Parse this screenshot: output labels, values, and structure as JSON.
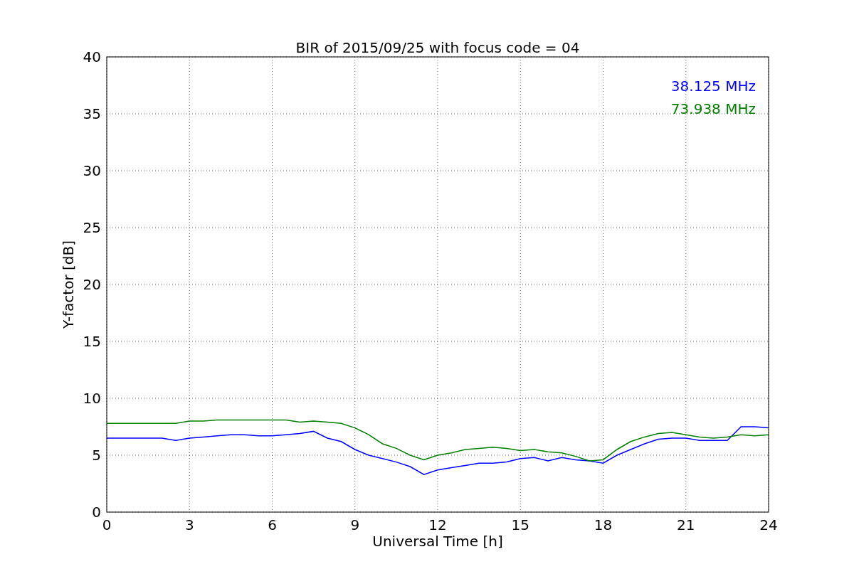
{
  "chart_data": {
    "type": "line",
    "title": "BIR of 2015/09/25 with focus code = 04",
    "xlabel": "Universal Time [h]",
    "ylabel": "Y-factor [dB]",
    "x": [
      0,
      0.5,
      1,
      1.5,
      2,
      2.5,
      3,
      3.5,
      4,
      4.5,
      5,
      5.5,
      6,
      6.5,
      7,
      7.5,
      8,
      8.5,
      9,
      9.5,
      10,
      10.5,
      11,
      11.5,
      12,
      12.5,
      13,
      13.5,
      14,
      14.5,
      15,
      15.5,
      16,
      16.5,
      17,
      17.5,
      18,
      18.5,
      19,
      19.5,
      20,
      20.5,
      21,
      21.5,
      22,
      22.5,
      23,
      23.5,
      24
    ],
    "series": [
      {
        "name": "38.125 MHz",
        "color": "#0000ff",
        "values": [
          6.5,
          6.5,
          6.5,
          6.5,
          6.5,
          6.3,
          6.5,
          6.6,
          6.7,
          6.8,
          6.8,
          6.7,
          6.7,
          6.8,
          6.9,
          7.1,
          6.5,
          6.2,
          5.5,
          5.0,
          4.7,
          4.4,
          4.0,
          3.3,
          3.7,
          3.9,
          4.1,
          4.3,
          4.3,
          4.4,
          4.7,
          4.8,
          4.5,
          4.8,
          4.6,
          4.5,
          4.3,
          5.0,
          5.5,
          6.0,
          6.4,
          6.5,
          6.5,
          6.3,
          6.3,
          6.3,
          7.5,
          7.5,
          7.4
        ]
      },
      {
        "name": "73.938 MHz",
        "color": "#008000",
        "values": [
          7.8,
          7.8,
          7.8,
          7.8,
          7.8,
          7.8,
          8.0,
          8.0,
          8.1,
          8.1,
          8.1,
          8.1,
          8.1,
          8.1,
          7.9,
          8.0,
          7.9,
          7.8,
          7.4,
          6.8,
          6.0,
          5.6,
          5.0,
          4.6,
          5.0,
          5.2,
          5.5,
          5.6,
          5.7,
          5.6,
          5.4,
          5.5,
          5.3,
          5.2,
          4.9,
          4.5,
          4.6,
          5.5,
          6.2,
          6.6,
          6.9,
          7.0,
          6.8,
          6.6,
          6.5,
          6.6,
          6.8,
          6.7,
          6.8
        ]
      }
    ],
    "grid": true,
    "xlim": [
      0,
      24
    ],
    "ylim": [
      0,
      40
    ],
    "xticks": [
      0,
      3,
      6,
      9,
      12,
      15,
      18,
      21,
      24
    ],
    "yticks": [
      0,
      5,
      10,
      15,
      20,
      25,
      30,
      35,
      40
    ]
  }
}
